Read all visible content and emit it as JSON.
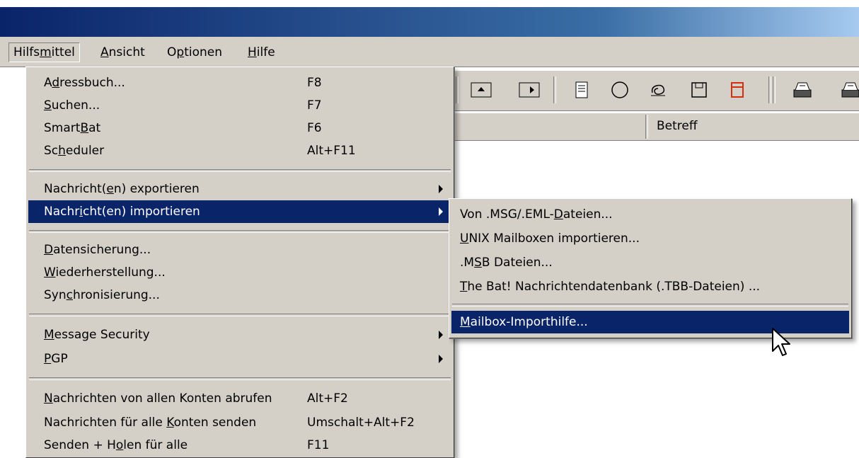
{
  "menubar": {
    "items": [
      {
        "label": "Hilfsmittel",
        "access": "m",
        "active": true
      },
      {
        "label": "Ansicht",
        "access": "A"
      },
      {
        "label": "Optionen",
        "access": "p"
      },
      {
        "label": "Hilfe",
        "access": "H"
      }
    ]
  },
  "list_header": {
    "subject_label": "Betreff"
  },
  "toolbar": {
    "icons": [
      "scroll-up-icon",
      "scroll-right-icon",
      "document-icon",
      "circle-icon",
      "clip-icon",
      "floppy-icon",
      "red-frame-icon",
      "mailbox-icon",
      "mailbox-icon"
    ]
  },
  "main_menu": {
    "items": [
      {
        "label": "Adressbuch...",
        "access": "d",
        "shortcut": "F8"
      },
      {
        "label": "Suchen...",
        "access": "S",
        "shortcut": "F7"
      },
      {
        "label": "SmartBat",
        "access": "B",
        "shortcut": "F6"
      },
      {
        "label": "Scheduler",
        "access": "h",
        "shortcut": "Alt+F11"
      },
      {
        "label": "Nachricht(en) exportieren",
        "access": "e",
        "submenu": true
      },
      {
        "label": "Nachricht(en) importieren",
        "access": "i",
        "submenu": true,
        "selected": true
      },
      {
        "label": "Datensicherung...",
        "access": "D"
      },
      {
        "label": "Wiederherstellung...",
        "access": "W"
      },
      {
        "label": "Synchronisierung...",
        "access": "c"
      },
      {
        "label": "Message Security",
        "access": "M",
        "submenu": true
      },
      {
        "label": "PGP",
        "access": "P",
        "submenu": true
      },
      {
        "label": "Nachrichten von allen Konten abrufen",
        "access": "N",
        "shortcut": "Alt+F2"
      },
      {
        "label": "Nachrichten für alle Konten senden",
        "access": "K",
        "shortcut": "Umschalt+Alt+F2"
      },
      {
        "label": "Senden + Holen für alle",
        "access": "o",
        "shortcut": "F11"
      }
    ]
  },
  "import_submenu": {
    "items": [
      {
        "label": "Von .MSG/.EML-Dateien...",
        "access": "D"
      },
      {
        "label": "UNIX Mailboxen importieren...",
        "access": "U"
      },
      {
        "label": ".MSB Dateien...",
        "access": "S"
      },
      {
        "label": "The Bat! Nachrichtendatenbank (.TBB-Dateien) ...",
        "access": "T"
      },
      {
        "label": "Mailbox-Importhilfe...",
        "access": "M",
        "selected": true
      }
    ]
  }
}
